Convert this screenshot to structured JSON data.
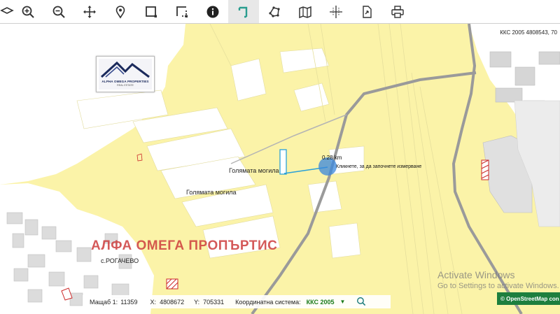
{
  "toolbar": {
    "buttons": [
      {
        "name": "layers",
        "icon": "layers-icon"
      },
      {
        "name": "zoom-in",
        "icon": "zoom-in-icon"
      },
      {
        "name": "zoom-out",
        "icon": "zoom-out-icon"
      },
      {
        "name": "pan",
        "icon": "move-icon"
      },
      {
        "name": "locate",
        "icon": "map-pin-icon"
      },
      {
        "name": "select-area",
        "icon": "select-box-icon"
      },
      {
        "name": "select-area-alt",
        "icon": "select-box-alt-icon"
      },
      {
        "name": "info",
        "icon": "info-icon"
      },
      {
        "name": "measure-distance",
        "icon": "measure-distance-icon",
        "active": true
      },
      {
        "name": "measure-area",
        "icon": "polygon-icon"
      },
      {
        "name": "map",
        "icon": "map-icon"
      },
      {
        "name": "coordinates",
        "icon": "crosshair-icon"
      },
      {
        "name": "export",
        "icon": "export-icon"
      },
      {
        "name": "print",
        "icon": "print-icon"
      }
    ]
  },
  "map": {
    "coord_readout": "ККС 2005 4808543, 70",
    "logo": {
      "name": "ALPHA OMEGA PROPERTIES",
      "sub": "REAL ESTATE"
    },
    "labels": {
      "place_1": "Голямата могила",
      "place_2": "Голямата могила",
      "village": "с.РОГАЧЕВО"
    },
    "measure": {
      "value": "0.28 km",
      "hint": "Кликнете, за да започнете измерване"
    },
    "watermark": "АЛФА ОМЕГА ПРОПЪРТИС",
    "os_notice": {
      "line1": "Activate Windows",
      "line2": "Go to Settings to activate Windows."
    },
    "attribution": "© OpenStreetMap con"
  },
  "status": {
    "scale_label": "Мащаб 1:",
    "scale_value": "11359",
    "x_label": "X:",
    "x_value": "4808672",
    "y_label": "Y:",
    "y_value": "705331",
    "system_label": "Координатна система:",
    "system_value": "ККС 2005",
    "system_arrow": "▼"
  },
  "colors": {
    "background": "#fbf3a8",
    "parcel": "#ffffff",
    "road": "#9a9a9a",
    "accent": "#2a9d8f",
    "measure": "#2aa0d8"
  }
}
